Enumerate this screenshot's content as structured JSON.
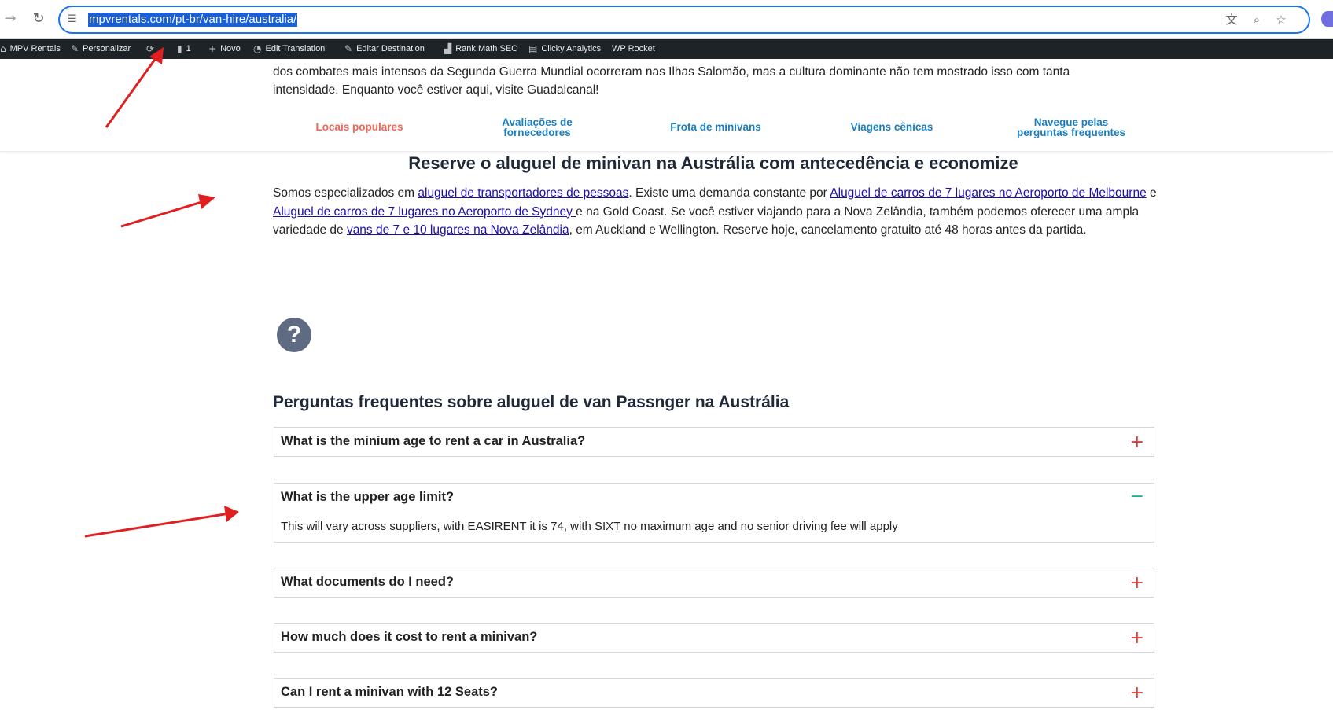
{
  "browser": {
    "url": "mpvrentals.com/pt-br/van-hire/australia/",
    "icons": [
      "back-icon",
      "reload-icon",
      "site-info-icon",
      "translate-icon",
      "zoom-icon",
      "bookmark-star-icon"
    ]
  },
  "adminbar": {
    "site": "MPV Rentals",
    "customize": "Personalizar",
    "comments_count": "1",
    "new": "Novo",
    "edit_translation": "Edit Translation",
    "edit_destination": "Editar Destination",
    "rank_math": "Rank Math SEO",
    "clicky": "Clicky Analytics",
    "wp_rocket": "WP Rocket"
  },
  "intro": {
    "line1": "dos combates mais intensos da Segunda Guerra Mundial ocorreram nas Ilhas Salomão, mas a cultura dominante não tem mostrado isso com tanta",
    "line2": "intensidade. Enquanto você estiver aqui, visite Guadalcanal!"
  },
  "tabs": [
    {
      "line1": "Locais populares",
      "line2": ""
    },
    {
      "line1": "Avaliações de",
      "line2": "fornecedores"
    },
    {
      "line1": "Frota de minivans",
      "line2": ""
    },
    {
      "line1": "Viagens cênicas",
      "line2": ""
    },
    {
      "line1": "Navegue pelas",
      "line2": "perguntas frequentes"
    }
  ],
  "section_title": "Reserve o aluguel de minivan na Austrália com antecedência e economize",
  "paragraph": {
    "t1": "Somos especializados em ",
    "link1": "aluguel de transportadores de pessoas",
    "t2": ".  Existe uma demanda constante por ",
    "link2": "Aluguel de carros de 7 lugares no Aeroporto de Melbourne",
    "t3": " e ",
    "link3": "Aluguel de carros de 7 lugares no Aeroporto de Sydney ",
    "t4": "e na Gold Coast. Se você estiver viajando para a Nova Zelândia, também podemos oferecer uma ampla variedade de ",
    "link4": "vans de 7 e 10 lugares na Nova Zelândia",
    "t5": ", em Auckland e Wellington. Reserve hoje, cancelamento gratuito até 48 horas antes da partida."
  },
  "help_icon": "?",
  "faq_heading": "Perguntas frequentes sobre aluguel de van Passnger na Austrália",
  "faqs": [
    {
      "question": "What is the minium age to rent a car in Australia?",
      "toggle": "+",
      "answer": ""
    },
    {
      "question": "What is the upper age limit?",
      "toggle": "−",
      "answer": "This will vary across suppliers, with EASIRENT it is 74, with SIXT no maximum age and no senior driving fee will apply"
    },
    {
      "question": "What documents do I need?",
      "toggle": "+",
      "answer": ""
    },
    {
      "question": "How much does it cost to rent a minivan?",
      "toggle": "+",
      "answer": ""
    },
    {
      "question": "Can I rent a minivan with 12 Seats?",
      "toggle": "+",
      "answer": ""
    }
  ],
  "colors": {
    "tab_link": "#1a7fc1",
    "tab_active": "#ee6655",
    "annotation_arrow": "#e02020",
    "toggle_plus": "#e53935",
    "toggle_minus": "#16b39a"
  }
}
